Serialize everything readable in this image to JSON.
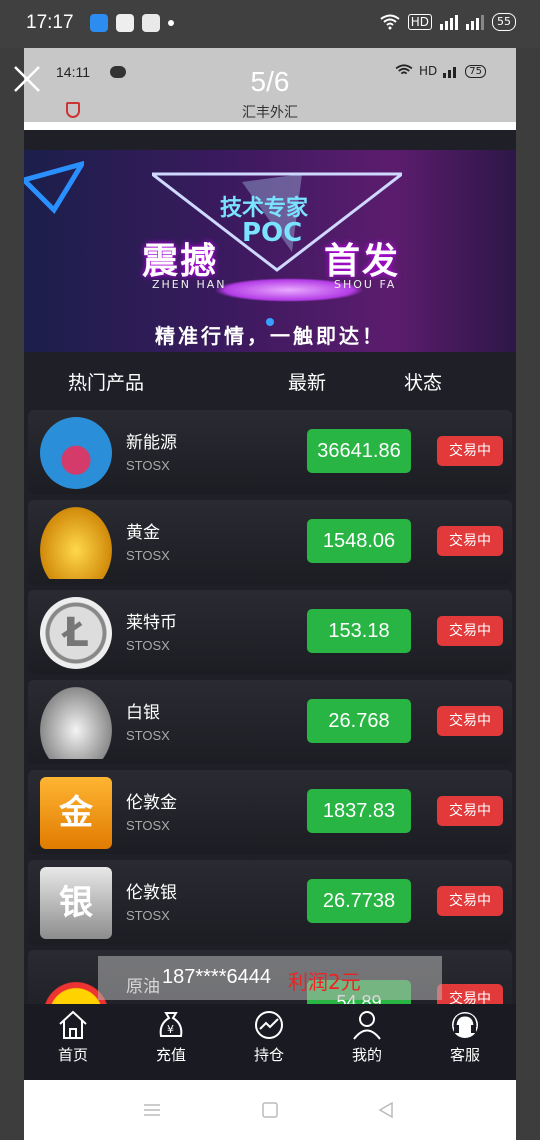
{
  "status_bar": {
    "time": "17:17",
    "right_text": "HD",
    "battery": "55"
  },
  "viewer": {
    "counter": "5/6"
  },
  "inner_status": {
    "time": "14:11",
    "right_text": "HD",
    "battery": "75",
    "title": "汇丰外汇"
  },
  "banner": {
    "expert": "技术专家",
    "poc": "POC",
    "word_left": "震撼",
    "word_right": "首发",
    "pinyin_left": "ZHEN HAN",
    "pinyin_right": "SHOU FA",
    "tagline": "精准行情，一触即达！"
  },
  "table": {
    "headers": [
      "热门产品",
      "最新",
      "状态"
    ],
    "rows": [
      {
        "name": "新能源",
        "code": "STOSX",
        "price": "36641.86",
        "status": "交易中",
        "icon": "new-energy-icon"
      },
      {
        "name": "黄金",
        "code": "STOSX",
        "price": "1548.06",
        "status": "交易中",
        "icon": "gold-ingot-icon"
      },
      {
        "name": "莱特币",
        "code": "STOSX",
        "price": "153.18",
        "status": "交易中",
        "icon": "litecoin-icon"
      },
      {
        "name": "白银",
        "code": "STOSX",
        "price": "26.768",
        "status": "交易中",
        "icon": "silver-ingot-icon"
      },
      {
        "name": "伦敦金",
        "code": "STOSX",
        "price": "1837.83",
        "status": "交易中",
        "icon": "london-gold-icon"
      },
      {
        "name": "伦敦银",
        "code": "STOSX",
        "price": "26.7738",
        "status": "交易中",
        "icon": "london-silver-icon"
      },
      {
        "name": "原油",
        "code": "",
        "price": "54.89",
        "status": "交易中",
        "icon": "crude-oil-icon"
      }
    ]
  },
  "toast": {
    "phone": "187****6444",
    "amount": "利润2元"
  },
  "tabs": [
    {
      "label": "首页",
      "icon": "home-icon"
    },
    {
      "label": "充值",
      "icon": "money-bag-icon"
    },
    {
      "label": "持仓",
      "icon": "chart-icon"
    },
    {
      "label": "我的",
      "icon": "user-icon"
    },
    {
      "label": "客服",
      "icon": "headset-icon"
    }
  ],
  "colors": {
    "price_bg": "#29b544",
    "status_bg": "#e23a3a",
    "page_bg": "#1f2027"
  }
}
